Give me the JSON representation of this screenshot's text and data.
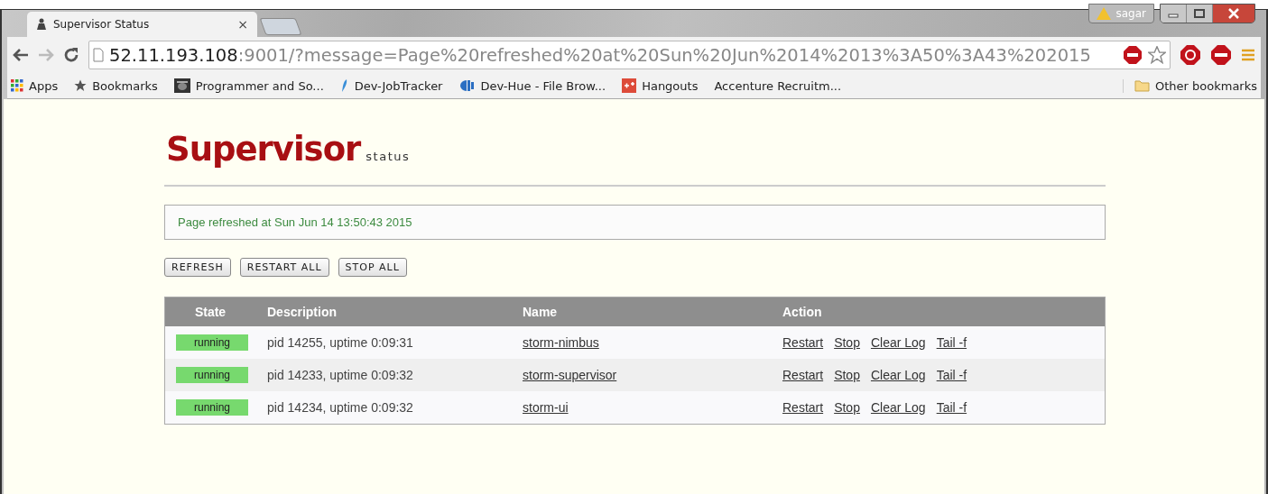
{
  "window": {
    "user": "sagar"
  },
  "tabs": [
    {
      "title": "Supervisor Status",
      "close": "×",
      "selected": true
    },
    {
      "kind": "new",
      "selected": false
    }
  ],
  "address_bar": {
    "host": "52.11.193.108",
    "rest": ":9001/?message=Page%20refreshed%20at%20Sun%20Jun%2014%2013%3A50%3A43%202015"
  },
  "bookmarks": [
    {
      "label": "Apps",
      "kind": "apps"
    },
    {
      "label": "Bookmarks",
      "kind": "star"
    },
    {
      "label": "Programmer and So...",
      "kind": "image"
    },
    {
      "label": "Dev-JobTracker",
      "kind": "feather"
    },
    {
      "label": "Dev-Hue - File Brow...",
      "kind": "hue"
    },
    {
      "label": "Hangouts",
      "kind": "gplus"
    },
    {
      "label": "Accenture Recruitm...",
      "kind": "none"
    }
  ],
  "other_bookmarks": "Other bookmarks",
  "page": {
    "logo": "Supervisor",
    "logo_sub": "status",
    "message": "Page refreshed at Sun Jun 14 13:50:43 2015",
    "buttons": [
      "REFRESH",
      "RESTART ALL",
      "STOP ALL"
    ],
    "table": {
      "columns": [
        "State",
        "Description",
        "Name",
        "Action"
      ],
      "rows": [
        {
          "state": "running",
          "color": "#77d96e",
          "description": "pid 14255, uptime 0:09:31",
          "name": "storm-nimbus",
          "actions": [
            "Restart",
            "Stop",
            "Clear Log",
            "Tail -f"
          ]
        },
        {
          "state": "running",
          "color": "#77d96e",
          "description": "pid 14233, uptime 0:09:32",
          "name": "storm-supervisor",
          "actions": [
            "Restart",
            "Stop",
            "Clear Log",
            "Tail -f"
          ]
        },
        {
          "state": "running",
          "color": "#77d96e",
          "description": "pid 14234, uptime 0:09:32",
          "name": "storm-ui",
          "actions": [
            "Restart",
            "Stop",
            "Clear Log",
            "Tail -f"
          ]
        }
      ]
    }
  }
}
